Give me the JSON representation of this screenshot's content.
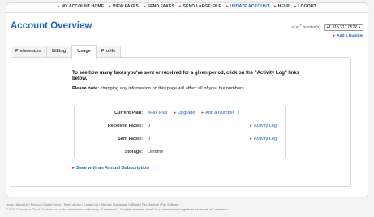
{
  "nav": {
    "items": [
      {
        "label": "MY ACCOUNT HOME",
        "active": false
      },
      {
        "label": "VIEW FAXES",
        "active": false
      },
      {
        "label": "SEND FAXES",
        "active": false
      },
      {
        "label": "SEND LARGE FILE",
        "active": false
      },
      {
        "label": "UPDATE ACCOUNT",
        "active": true
      },
      {
        "label": "HELP",
        "active": false
      },
      {
        "label": "LOGOUT",
        "active": false
      }
    ],
    "arrow_glyph": "▸"
  },
  "page": {
    "title": "Account Overview"
  },
  "number": {
    "label_prefix": "eFax",
    "label_sup": "®",
    "label_suffix": " Number(s):",
    "selected": "+1 315 217 0527",
    "add_label": "Add a Number"
  },
  "tabs": [
    {
      "label": "Preferences",
      "active": false
    },
    {
      "label": "Billing",
      "active": false
    },
    {
      "label": "Usage",
      "active": true
    },
    {
      "label": "Profile",
      "active": false
    }
  ],
  "usage": {
    "intro": "To see how many faxes you've sent or received for a given period, click on the \"Activity Log\" links below.",
    "note_bold": "Please note:",
    "note_text": " changing any information on this page will affect all of your fax numbers.",
    "rows": {
      "plan": {
        "label": "Current Plan:",
        "value": "eFax Plus",
        "upgrade": "Upgrade",
        "add": "Add a Number",
        "sep": "|"
      },
      "received": {
        "label": "Received Faxes:",
        "value": "0",
        "link": "Activity Log"
      },
      "sent": {
        "label": "Sent Faxes:",
        "value": "0",
        "link": "Activity Log"
      },
      "storage": {
        "label": "Storage:",
        "value": "Lifetime"
      }
    },
    "save_label": "Save with an Annual Subscription"
  },
  "footer": {
    "links": "Home | About Us | Privacy | Cookie Policy | Terms of Use | Contact Us | Sitemap | Language | Affiliate | Fax Machine | Fax Software",
    "copyright": "© 2023 Consensus Cloud Solutions Inc. or its subsidiaries (collectively, \"Consensus\"). All rights reserved. eFax® is a trademark and registered trademark of Consensus."
  },
  "colors": {
    "accent": "#1f63bf",
    "link": "#1a66c8",
    "arrow": "#e2402a"
  }
}
